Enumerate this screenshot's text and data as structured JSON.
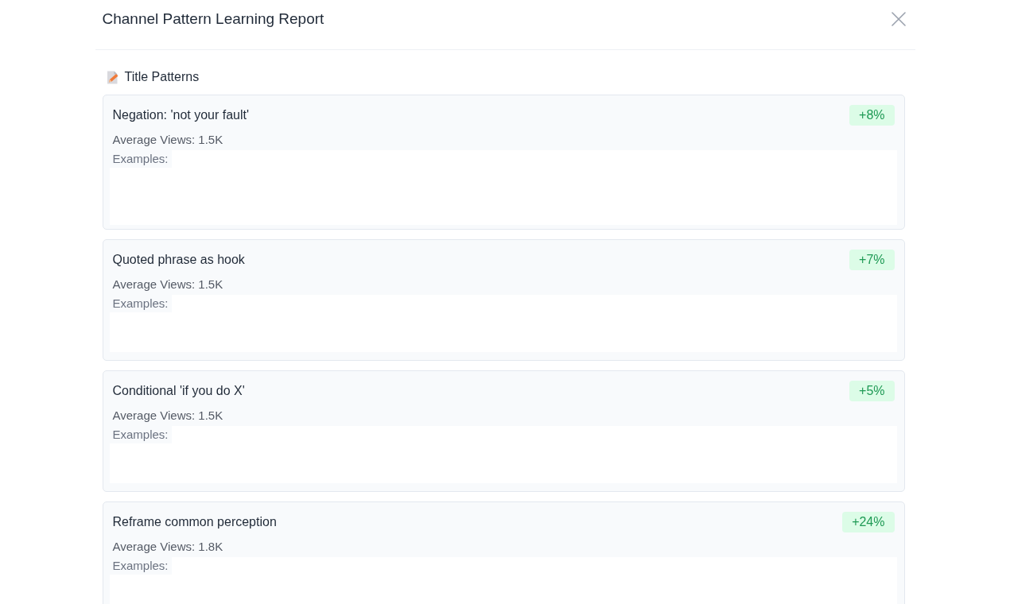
{
  "dialog": {
    "title": "Channel Pattern Learning Report"
  },
  "section": {
    "title": "Title Patterns"
  },
  "patterns": [
    {
      "name": "Negation: 'not your fault'",
      "change": "+8%",
      "average_views": "Average Views: 1.5K",
      "examples_label": "Examples:"
    },
    {
      "name": "Quoted phrase as hook",
      "change": "+7%",
      "average_views": "Average Views: 1.5K",
      "examples_label": "Examples:"
    },
    {
      "name": "Conditional 'if you do X'",
      "change": "+5%",
      "average_views": "Average Views: 1.5K",
      "examples_label": "Examples:"
    },
    {
      "name": "Reframe common perception",
      "change": "+24%",
      "average_views": "Average Views: 1.8K",
      "examples_label": "Examples:"
    }
  ]
}
